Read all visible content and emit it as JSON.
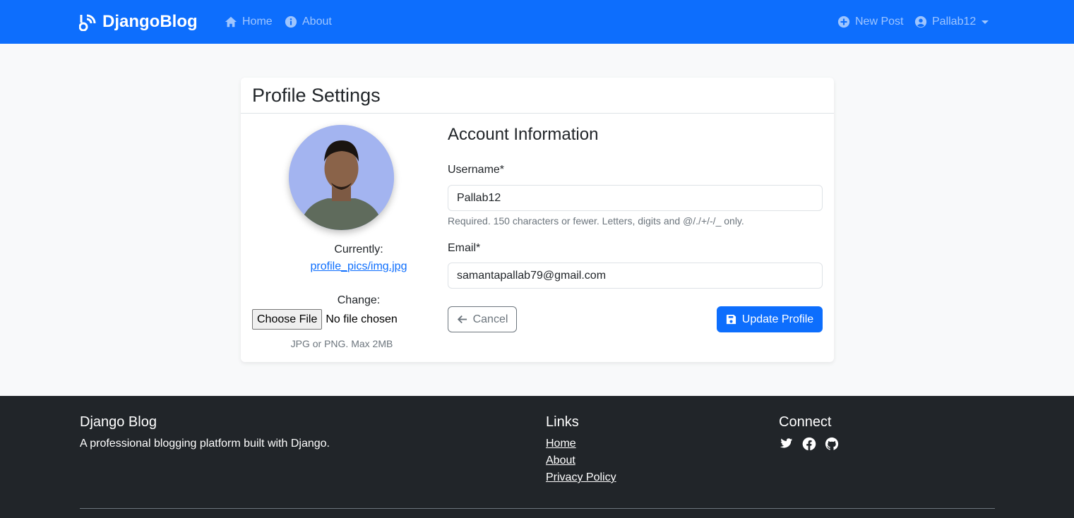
{
  "navbar": {
    "brand": "DjangoBlog",
    "home": "Home",
    "about": "About",
    "new_post": "New Post",
    "user": "Pallab12"
  },
  "profile": {
    "title": "Profile Settings",
    "currently_label": "Currently:",
    "current_file": "profile_pics/img.jpg",
    "change_label": "Change:",
    "choose_file": "Choose File",
    "file_status": "No file chosen",
    "file_hint": "JPG or PNG. Max 2MB"
  },
  "account": {
    "title": "Account Information",
    "username_label": "Username*",
    "username_value": "Pallab12",
    "username_help": "Required. 150 characters or fewer. Letters, digits and @/./+/-/_ only.",
    "email_label": "Email*",
    "email_value": "samantapallab79@gmail.com",
    "cancel": "Cancel",
    "update": "Update Profile"
  },
  "footer": {
    "brand_title": "Django Blog",
    "description": "A professional blogging platform built with Django.",
    "links_title": "Links",
    "links": [
      "Home",
      "About",
      "Privacy Policy"
    ],
    "connect_title": "Connect",
    "social_icons": [
      "twitter-icon",
      "facebook-icon",
      "github-icon"
    ]
  },
  "colors": {
    "primary": "#0d6efd",
    "footer_bg": "#212529",
    "page_bg": "#f8f9fa"
  }
}
